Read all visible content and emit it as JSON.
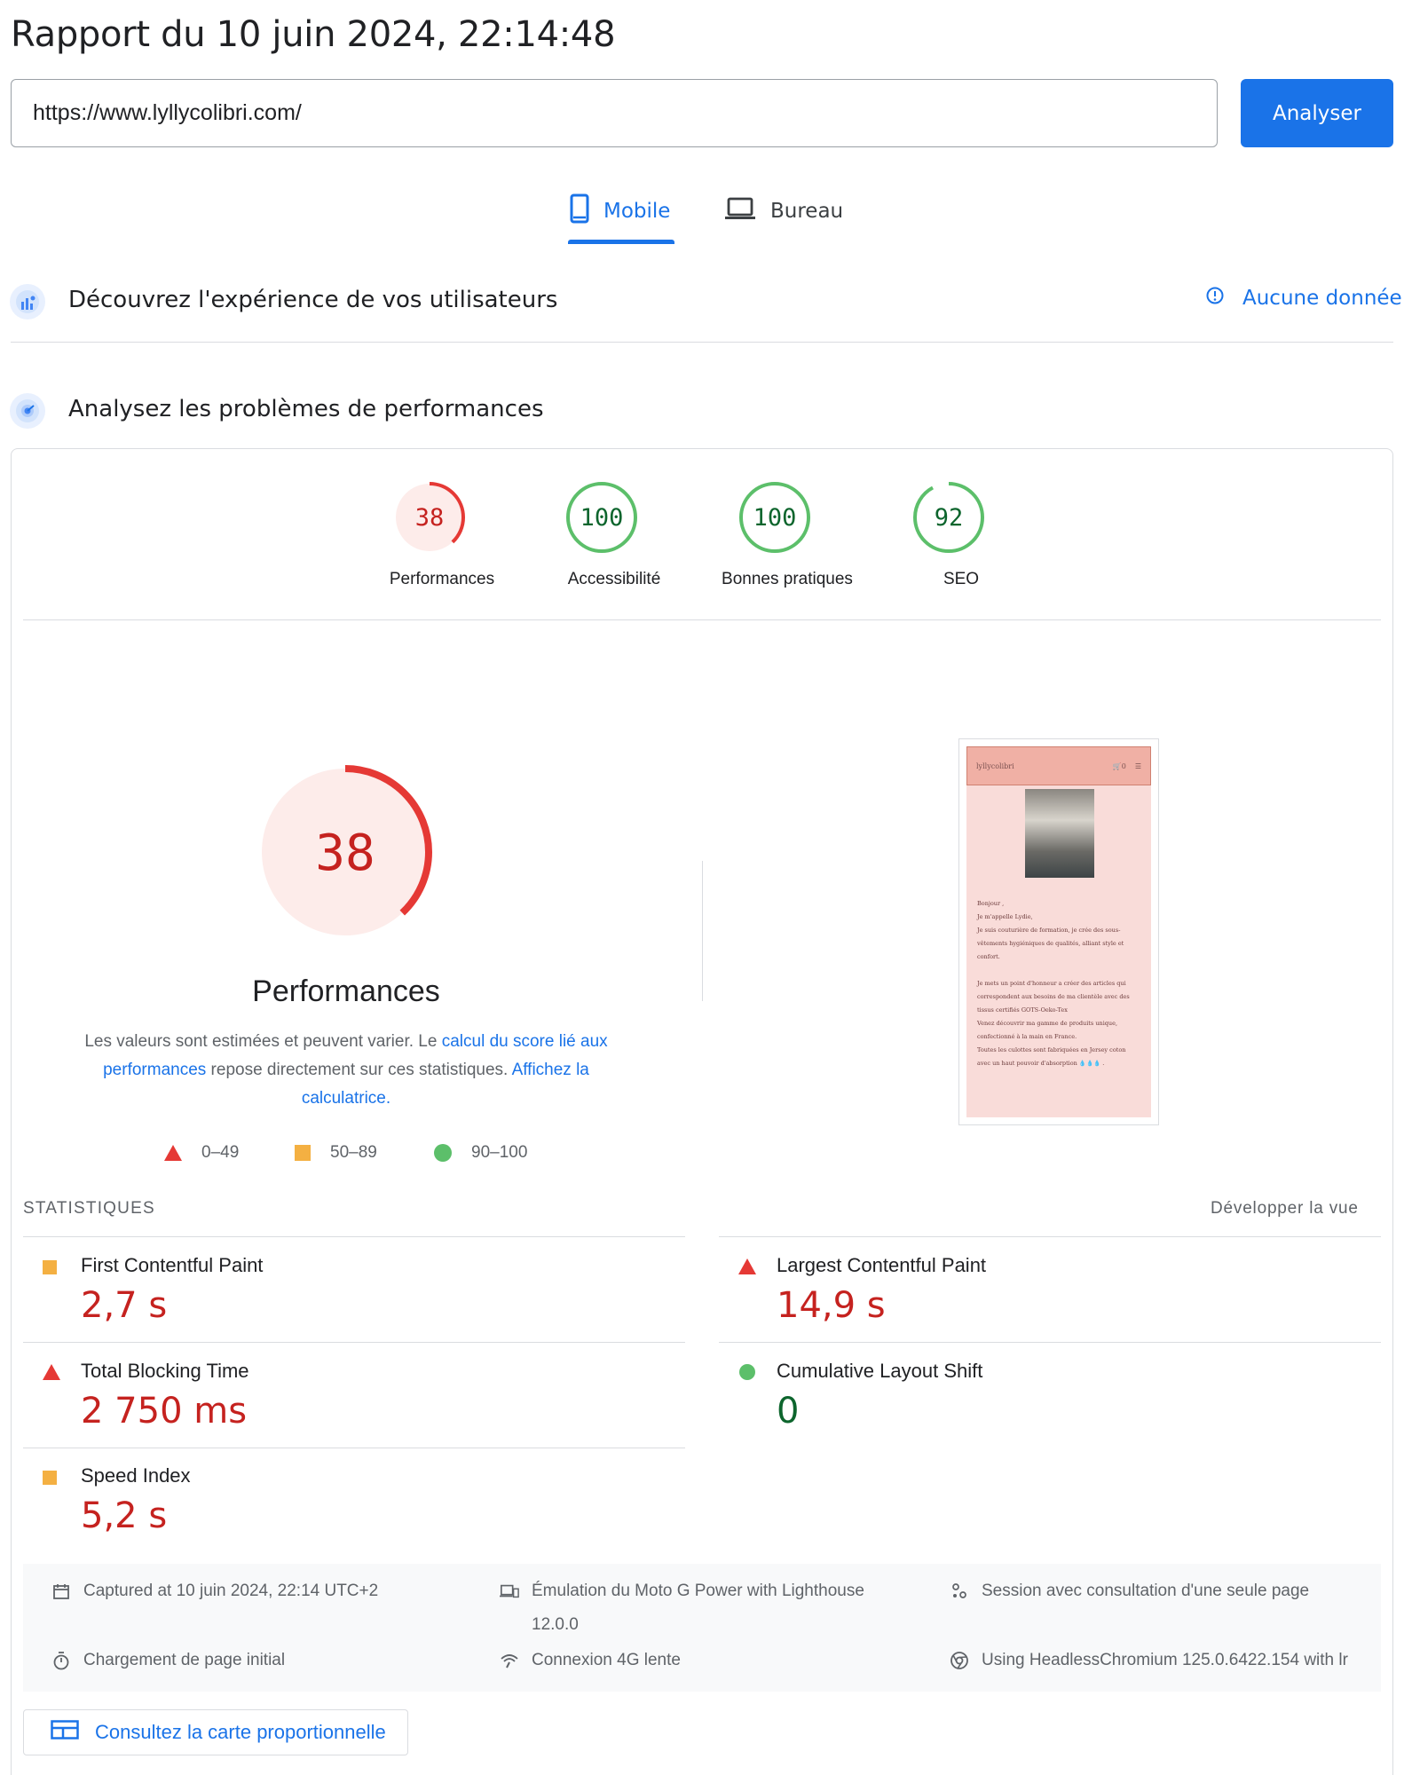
{
  "header": {
    "report_title": "Rapport du 10 juin 2024, 22:14:48",
    "url_value": "https://www.lyllycolibri.com/",
    "analyze_label": "Analyser"
  },
  "tabs": [
    {
      "label": "Mobile",
      "icon": "phone-icon",
      "active": true
    },
    {
      "label": "Bureau",
      "icon": "laptop-icon",
      "active": false
    }
  ],
  "field_section": {
    "title": "Découvrez l'expérience de vos utilisateurs",
    "status": "Aucune donnée",
    "icon": "users-chart-icon"
  },
  "lab_section": {
    "title": "Analysez les problèmes de performances",
    "icon": "lab-icon"
  },
  "scores": [
    {
      "label": "Performances",
      "value": "38",
      "score": 38,
      "color": "#e53935",
      "bg": "#fdecea",
      "text_color": "#c5221f"
    },
    {
      "label": "Accessibilité",
      "value": "100",
      "score": 100,
      "color": "#5cbf6a",
      "bg": "#ffffff",
      "text_color": "#0d652d"
    },
    {
      "label": "Bonnes pratiques",
      "value": "100",
      "score": 100,
      "color": "#5cbf6a",
      "bg": "#ffffff",
      "text_color": "#0d652d"
    },
    {
      "label": "SEO",
      "value": "92",
      "score": 92,
      "color": "#5cbf6a",
      "bg": "#ffffff",
      "text_color": "#0d652d"
    }
  ],
  "performance": {
    "score": "38",
    "score_value": 38,
    "title": "Performances",
    "desc_part1": "Les valeurs sont estimées et peuvent varier. Le ",
    "desc_link1": "calcul du score lié aux performances",
    "desc_part2": " repose directement sur ces statistiques. ",
    "desc_link2": "Affichez la calculatrice.",
    "legend": [
      {
        "shape": "triangle",
        "range": "0–49",
        "color": "#e53935"
      },
      {
        "shape": "square",
        "range": "50–89",
        "color": "#f4b042"
      },
      {
        "shape": "circle",
        "range": "90–100",
        "color": "#5cbf6a"
      }
    ]
  },
  "thumbnail": {
    "site_name": "lyllycolibri",
    "cart": "0",
    "lines": [
      "Bonjour ,",
      "Je m'appelle Lydie,",
      "Je suis couturière de formation, je crée des sous-",
      "vêtements hygiéniques de qualités, alliant style et",
      "confort.",
      "",
      "Je mets un point d'honneur a créer des articles qui",
      "correspondent aux besoins de ma clientèle avec des",
      "tissus certifiés GOTS-Oeko-Tex",
      "Venez découvrir ma gamme de produits unique,",
      "confectionné à la main en France.",
      "Toutes les culottes sont fabriquées en Jersey coton",
      "avec un haut pouvoir d'absorption 💧💧💧 ."
    ]
  },
  "stats": {
    "header": "STATISTIQUES",
    "expand": "Développer la vue",
    "metrics": [
      {
        "label": "First Contentful Paint",
        "value": "2,7 s",
        "rating": "average"
      },
      {
        "label": "Largest Contentful Paint",
        "value": "14,9 s",
        "rating": "fail"
      },
      {
        "label": "Total Blocking Time",
        "value": "2 750 ms",
        "rating": "fail"
      },
      {
        "label": "Cumulative Layout Shift",
        "value": "0",
        "rating": "pass"
      },
      {
        "label": "Speed Index",
        "value": "5,2 s",
        "rating": "average"
      }
    ]
  },
  "environment": {
    "captured": "Captured at 10 juin 2024, 22:14 UTC+2",
    "emulation": "Émulation du Moto G Power with Lighthouse",
    "emulation_version": "12.0.0",
    "session": "Session avec consultation d'une seule page",
    "load": "Chargement de page initial",
    "network": "Connexion 4G lente",
    "browser": "Using HeadlessChromium 125.0.6422.154 with lr"
  },
  "treemap_label": "Consultez la carte proportionnelle",
  "colors": {
    "accent": "#1a73e8",
    "fail": "#e53935",
    "average": "#f4b042",
    "pass": "#5cbf6a"
  }
}
